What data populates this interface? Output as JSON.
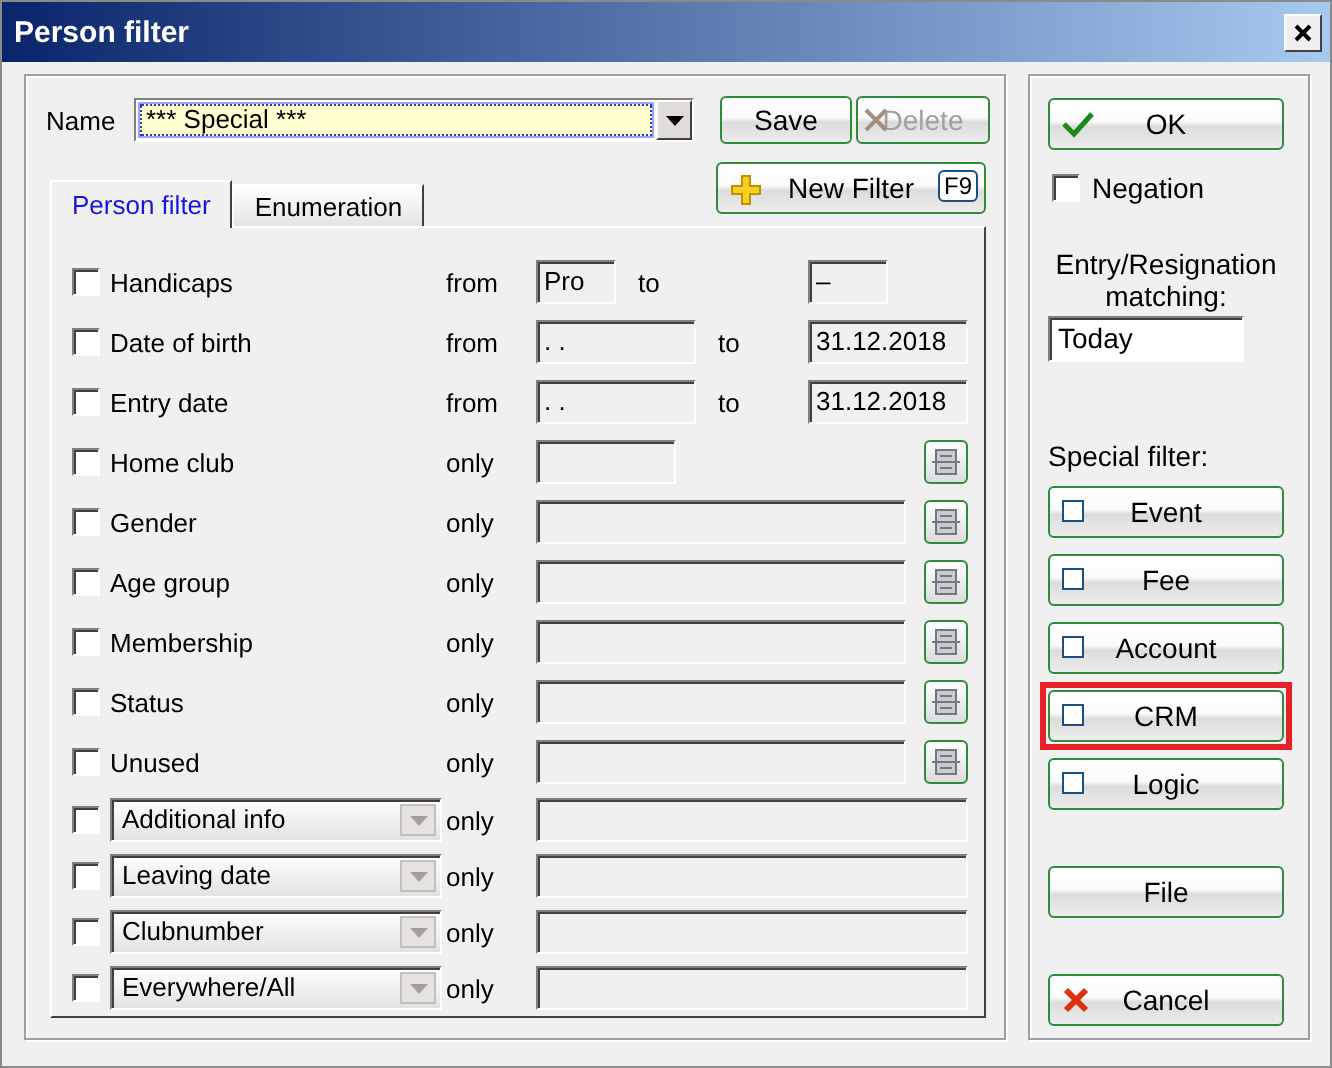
{
  "window": {
    "title": "Person filter"
  },
  "name": {
    "label": "Name",
    "value": "*** Special ***"
  },
  "buttons": [
    {
      "label": "Save",
      "disabled": false
    },
    {
      "label": "Delete",
      "disabled": true
    }
  ],
  "new_filter": {
    "label": "New Filter",
    "shortcut": "F9"
  },
  "tabs": [
    {
      "label": "Person filter",
      "selected": true
    },
    {
      "label": "Enumeration",
      "selected": false
    }
  ],
  "rows": [
    {
      "kind": "range",
      "label": "Handicaps",
      "checked": false,
      "from_word": "from",
      "from": "Pro",
      "to_word": "to",
      "to": "–"
    },
    {
      "kind": "range",
      "label": "Date of birth",
      "checked": false,
      "from_word": "from",
      "from": ". .",
      "to_word": "to",
      "to": "31.12.2018"
    },
    {
      "kind": "range",
      "label": "Entry date",
      "checked": false,
      "from_word": "from",
      "from": ". .",
      "to_word": "to",
      "to": "31.12.2018"
    },
    {
      "kind": "lookup",
      "label": "Home club",
      "checked": false,
      "word": "only"
    },
    {
      "kind": "list",
      "label": "Gender",
      "checked": false,
      "word": "only"
    },
    {
      "kind": "list",
      "label": "Age group",
      "checked": false,
      "word": "only"
    },
    {
      "kind": "list",
      "label": "Membership",
      "checked": false,
      "word": "only"
    },
    {
      "kind": "list",
      "label": "Status",
      "checked": false,
      "word": "only"
    },
    {
      "kind": "list",
      "label": "Unused",
      "checked": false,
      "word": "only"
    },
    {
      "kind": "choice",
      "label": "Additional info",
      "checked": false,
      "word": "only"
    },
    {
      "kind": "choice",
      "label": "Leaving date",
      "checked": false,
      "word": "only"
    },
    {
      "kind": "choice",
      "label": "Clubnumber",
      "checked": false,
      "word": "only"
    },
    {
      "kind": "choice",
      "label": "Everywhere/All",
      "checked": false,
      "word": "only"
    }
  ],
  "side": {
    "ok": "OK",
    "negation": {
      "label": "Negation",
      "checked": false
    },
    "matching": {
      "label": "Entry/Resignation matching:",
      "value": "Today"
    },
    "special_label": "Special filter:",
    "special_filters": [
      {
        "label": "Event",
        "checked": false,
        "highlighted": false
      },
      {
        "label": "Fee",
        "checked": false,
        "highlighted": false
      },
      {
        "label": "Account",
        "checked": false,
        "highlighted": false
      },
      {
        "label": "CRM",
        "checked": false,
        "highlighted": true
      },
      {
        "label": "Logic",
        "checked": false,
        "highlighted": false
      }
    ],
    "file": "File",
    "cancel": "Cancel"
  }
}
